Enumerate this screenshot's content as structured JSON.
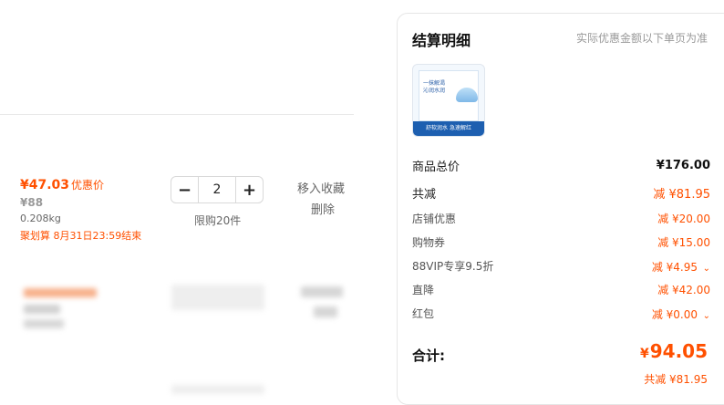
{
  "cart": {
    "item": {
      "price": "¥47.03",
      "price_tag": "优惠价",
      "original_price": "¥88",
      "weight": "0.208kg",
      "promo": "聚划算 8月31日23:59结束",
      "quantity": "2",
      "limit": "限购20件",
      "actions": {
        "favorite": "移入收藏",
        "delete": "删除"
      }
    }
  },
  "summary": {
    "title": "结算明细",
    "note": "实际优惠金额以下单页为准",
    "thumb": {
      "caption": "一抹解渴 沁润水润",
      "band": "舒软润水 急速解红"
    },
    "rows": [
      {
        "label": "商品总价",
        "value": "¥176.00"
      },
      {
        "label": "共减",
        "value": "减 ¥81.95"
      },
      {
        "label": "店铺优惠",
        "value": "减 ¥20.00"
      },
      {
        "label": "购物券",
        "value": "减 ¥15.00"
      },
      {
        "label": "88VIP专享9.5折",
        "value": "减 ¥4.95"
      },
      {
        "label": "直降",
        "value": "减 ¥42.00"
      },
      {
        "label": "红包",
        "value": "减 ¥0.00"
      }
    ],
    "total_label": "合计:",
    "total_currency": "¥",
    "total_value": "94.05",
    "saved": "共减 ¥81.95"
  },
  "icons": {
    "dropdown": "chevron-down-icon",
    "minus": "minus-icon",
    "plus": "plus-icon"
  },
  "colors": {
    "accent": "#ff5000",
    "border": "#e6e6e6"
  }
}
